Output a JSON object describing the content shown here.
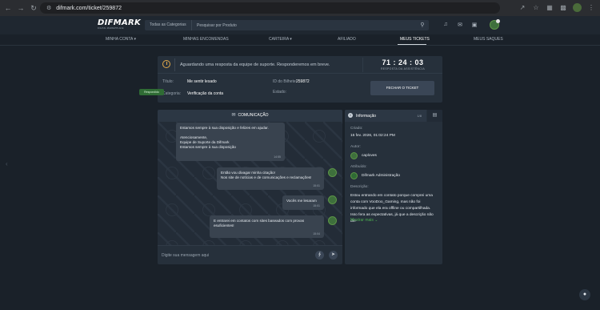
{
  "browser": {
    "url": "difmark.com/ticket/259872",
    "icons": [
      "back-icon",
      "forward-icon",
      "reload-icon",
      "site-info-icon",
      "share-icon",
      "bookmark-icon",
      "extensions-icon",
      "profile-icon",
      "menu-icon"
    ]
  },
  "header": {
    "logo_text": "DIFMARK",
    "logo_subtitle": "DIGITAL MARKETPLACE",
    "category_label": "Todas as Categorias",
    "search_placeholder": "Pesquisar por Produto",
    "icons": [
      "search-icon",
      "bell-icon",
      "gift-icon",
      "wallet-icon"
    ]
  },
  "nav": {
    "items": [
      "MINHA CONTA",
      "MINHAS ENCOMENDAS",
      "CARTEIRA",
      "AFILIADO",
      "MEUS TICKETS",
      "MEUS SAQUES"
    ],
    "active": "MEUS TICKETS"
  },
  "status": {
    "message": "Aguardando uma resposta da equipe de suporte. Responderemos em breve.",
    "timer": "71 : 24 : 03",
    "timer_label": "RESPOSTA DA ASSISTÊNCIA",
    "title_label": "Título:",
    "title_value": "Me sentir lesado",
    "category_label": "Categoria:",
    "category_value": "Verificação da conta",
    "ticket_id_label": "ID do Bilhete:",
    "ticket_id_value": "259872",
    "state_label": "Estado:",
    "state_value": "Respondido",
    "close_button": "FECHAR O TICKET"
  },
  "chat": {
    "title": "COMUNICAÇÃO",
    "messages": [
      {
        "lines": [
          "Estamos sempre à sua disposição e felizes em ajudar.",
          "",
          "Atenciosamente,",
          "Equipe de Suporte da Difmark",
          "Estamos sempre à sua disposição"
        ],
        "time": "14:55"
      },
      {
        "lines": [
          "Então vou divagar minha citação!",
          "Nos site de notícias e de comunicações e reclamações!"
        ],
        "time": "15:01"
      },
      {
        "lines": [
          "Vocês me lesaram"
        ],
        "time": "15:01"
      },
      {
        "lines": [
          "E entrarei em contatos com sites baseados com provas",
          "esuficientes!"
        ],
        "time": "15:04"
      }
    ],
    "input_placeholder": "Digite sua mensagem aqui"
  },
  "info": {
    "tab_label": "Informação",
    "tab_page": "1/8",
    "created_label": "Criado:",
    "created_value": "15 fev. 2026, 01:02:24 PM",
    "author_label": "Autor:",
    "author_value": "caploves",
    "assigned_label": "Atribuído:",
    "assigned_value": "Difmark Administração",
    "description_label": "Descrição:",
    "description_value": "Estou entrando em contato porque comprei uma conta com VooDoo_Gaming, mas não foi informado que ela era offline ou compartilhada. Isso fera as expectativas, já que a descrição não dei-",
    "show_more": "Mostrar mais"
  },
  "colors": {
    "page_bg": "#1a2129",
    "card_bg": "#26303b",
    "accent_green": "#4caf50",
    "timer_icon": "#e0a84a"
  }
}
